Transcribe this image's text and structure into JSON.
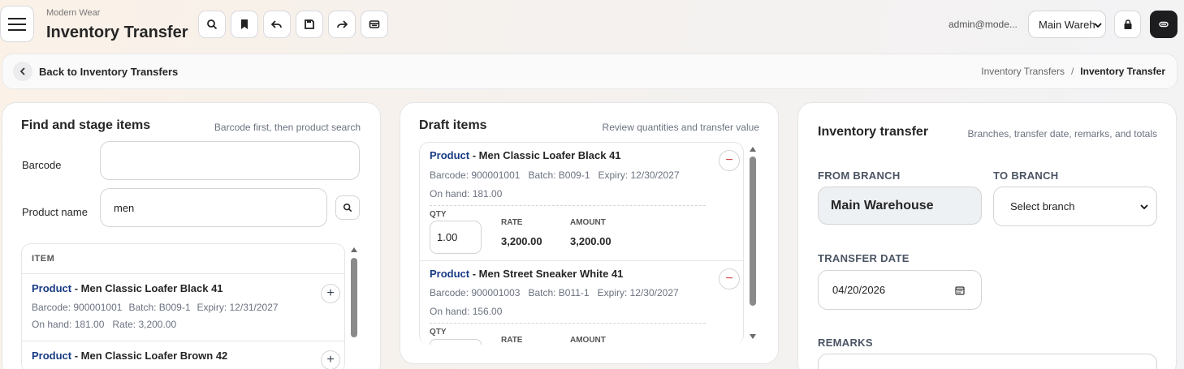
{
  "header": {
    "company": "Modern Wear",
    "title": "Inventory Transfer",
    "user": "admin@mode...",
    "branch_select": "Main Wareh"
  },
  "subheader": {
    "back_label": "Back to Inventory Transfers",
    "breadcrumb": {
      "parent": "Inventory Transfers",
      "separator": "/",
      "current": "Inventory Transfer"
    }
  },
  "find": {
    "title": "Find and stage items",
    "hint": "Barcode first, then product search",
    "barcode_label": "Barcode",
    "barcode_value": "",
    "product_label": "Product name",
    "product_value": "men",
    "table_header": "ITEM",
    "items": [
      {
        "prefix": "Product",
        "name": " - Men Classic Loafer Black 41",
        "barcode": "Barcode: 900001001",
        "batch": "Batch: B009-1",
        "expiry": "Expiry: 12/31/2027",
        "onhand": "On hand: 181.00",
        "rate": "Rate: 3,200.00"
      },
      {
        "prefix": "Product",
        "name": " - Men Classic Loafer Brown 42"
      }
    ]
  },
  "draft": {
    "title": "Draft items",
    "hint": "Review quantities and transfer value",
    "qty_label": "QTY",
    "rate_label": "RATE",
    "amount_label": "AMOUNT",
    "items": [
      {
        "prefix": "Product",
        "name": " - Men Classic Loafer Black 41",
        "barcode": "Barcode: 900001001",
        "batch": "Batch: B009-1",
        "expiry": "Expiry: 12/30/2027",
        "onhand": "On hand: 181.00",
        "qty": "1.00",
        "rate": "3,200.00",
        "amount": "3,200.00"
      },
      {
        "prefix": "Product",
        "name": " - Men Street Sneaker White 41",
        "barcode": "Barcode: 900001003",
        "batch": "Batch: B011-1",
        "expiry": "Expiry: 12/30/2027",
        "onhand": "On hand: 156.00"
      }
    ]
  },
  "transfer": {
    "title": "Inventory transfer",
    "hint": "Branches, transfer date, remarks, and totals",
    "from_label": "FROM BRANCH",
    "from_value": "Main Warehouse",
    "to_label": "TO BRANCH",
    "to_value": "Select branch",
    "date_label": "TRANSFER DATE",
    "date_value": "04/20/2026",
    "remarks_label": "REMARKS"
  },
  "icons": [
    "menu-icon",
    "search-icon",
    "bookmark-icon",
    "undo-icon",
    "save-icon",
    "redo-icon",
    "archive-icon",
    "lock-icon",
    "unlink-icon",
    "chevron-left-icon",
    "calendar-icon",
    "plus-icon",
    "minus-icon"
  ]
}
